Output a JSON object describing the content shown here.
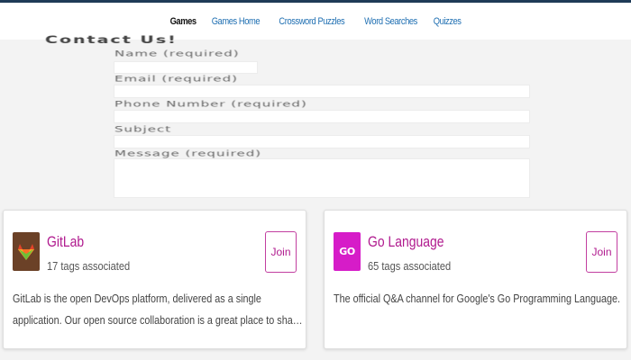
{
  "nav": {
    "items": [
      {
        "label": "Games",
        "active": true
      },
      {
        "label": "Games Home",
        "active": false
      },
      {
        "label": "Crossword Puzzles",
        "active": false
      },
      {
        "label": "Word Searches",
        "active": false
      },
      {
        "label": "Quizzes",
        "active": false
      }
    ]
  },
  "contact_form": {
    "title": "Contact Us!",
    "name_label": "Name (required)",
    "email_label": "Email (required)",
    "phone_label": "Phone Number (required)",
    "subject_label": "Subject",
    "message_label": "Message (required)"
  },
  "cards": [
    {
      "title": "GitLab",
      "tags": "17 tags associated",
      "join_label": "Join",
      "desc_line_1": "GitLab is the open DevOps platform, delivered as a single",
      "desc_line_2": "application. Our open source collaboration is a great place to sha…",
      "logo_icon": "gitlab-fox-icon",
      "logo_color": "#6b4127"
    },
    {
      "title": "Go Language",
      "tags": "65 tags associated",
      "join_label": "Join",
      "desc_line_1": "The official Q&A channel for Google's Go Programming Language.",
      "desc_line_2": "",
      "logo_icon": "go-logo-icon",
      "logo_text": "GO",
      "logo_color": "#d61cc8"
    }
  ],
  "colors": {
    "accent": "#b01a8e",
    "nav_link": "#1f6fb2",
    "topline": "#1f3b57"
  }
}
